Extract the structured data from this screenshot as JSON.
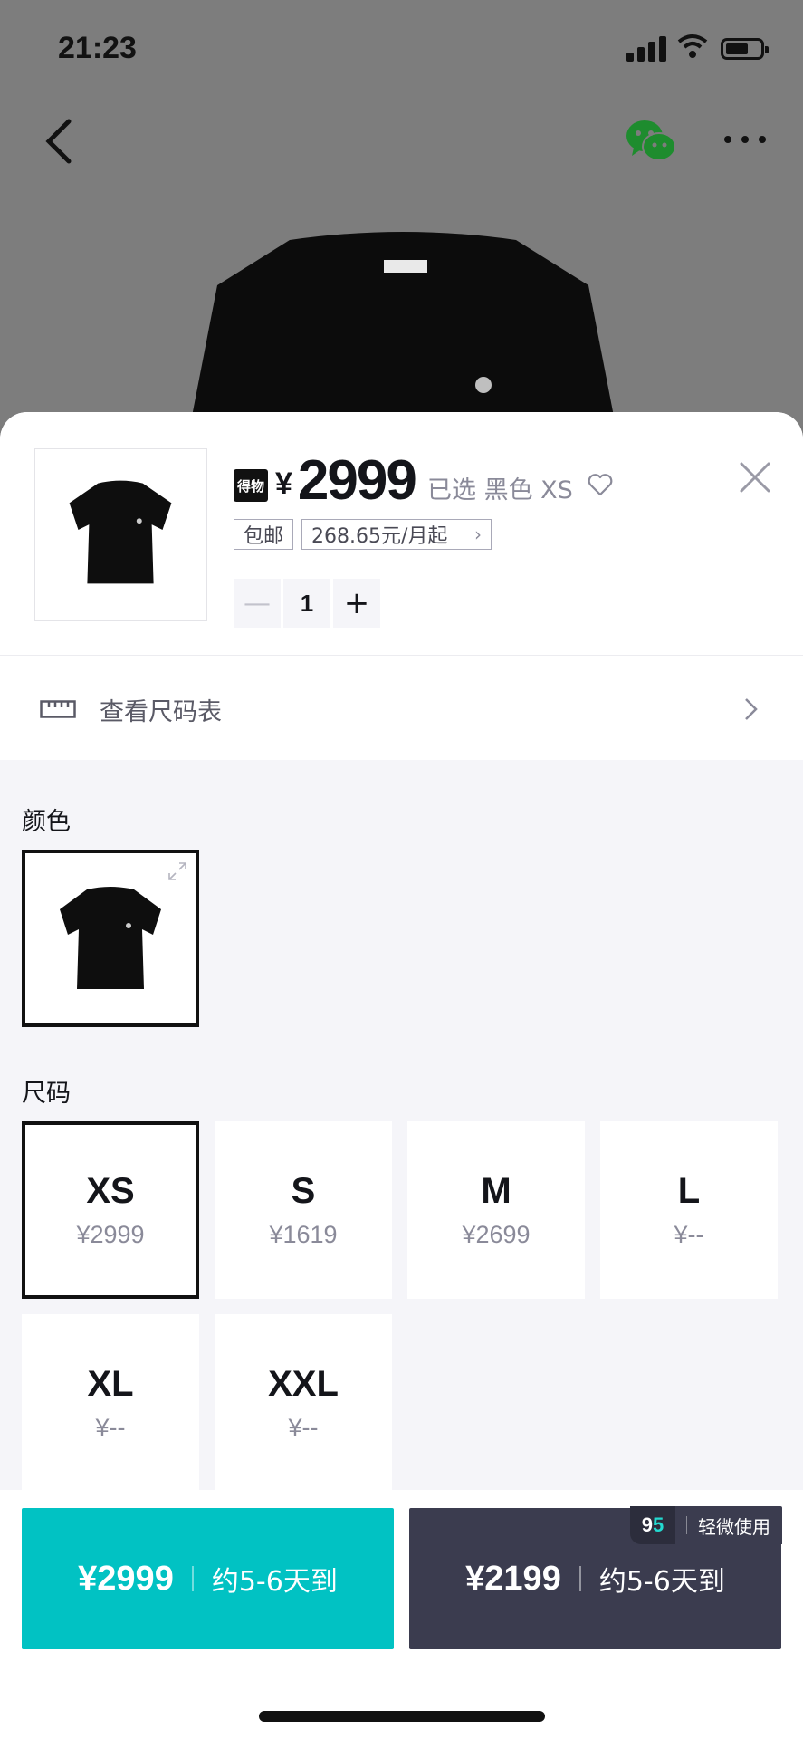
{
  "status_bar": {
    "time": "21:23"
  },
  "product": {
    "brand_badge": "得物",
    "currency": "¥",
    "price": "2999",
    "selected_text": "已选 黑色 XS",
    "tags": {
      "shipping": "包邮",
      "installment": "268.65元/月起"
    },
    "quantity": "1"
  },
  "size_chart": {
    "label": "查看尺码表"
  },
  "sections": {
    "color_title": "颜色",
    "size_title": "尺码"
  },
  "sizes": [
    {
      "name": "XS",
      "price": "¥2999",
      "selected": true
    },
    {
      "name": "S",
      "price": "¥1619"
    },
    {
      "name": "M",
      "price": "¥2699"
    },
    {
      "name": "L",
      "price": "¥--"
    },
    {
      "name": "XL",
      "price": "¥--"
    },
    {
      "name": "XXL",
      "price": "¥--"
    }
  ],
  "buy_new": {
    "price": "¥2999",
    "delivery": "约5-6天到"
  },
  "buy_used": {
    "price": "¥2199",
    "delivery": "约5-6天到",
    "badge_logo_a": "9",
    "badge_logo_b": "5",
    "badge_text": "轻微使用"
  },
  "colors": {
    "accent_teal": "#01c2c3",
    "dark_button": "#3b3c4f",
    "background": "#f5f5f9"
  }
}
